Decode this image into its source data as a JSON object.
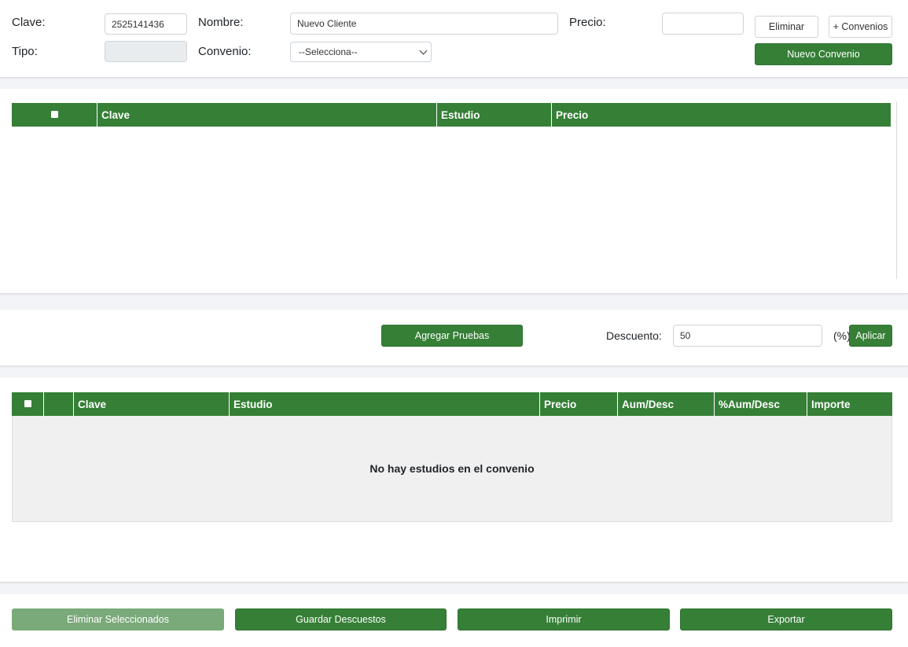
{
  "form": {
    "clave_label": "Clave:",
    "clave_value": "2525141436",
    "nombre_label": "Nombre:",
    "nombre_value": "Nuevo Cliente",
    "precio_label": "Precio:",
    "precio_value": "",
    "tipo_label": "Tipo:",
    "tipo_value": "",
    "convenio_label": "Convenio:",
    "convenio_selected": "--Selecciona--",
    "eliminar_label": "Eliminar",
    "mas_convenios_label": "+ Convenios",
    "nuevo_convenio_label": "Nuevo Convenio"
  },
  "studies_table": {
    "columns": [
      "Clave",
      "Estudio",
      "Precio"
    ],
    "rows": []
  },
  "actions": {
    "agregar_pruebas_label": "Agregar Pruebas",
    "descuento_label": "Descuento:",
    "descuento_value": "50",
    "percent_label": "(%)",
    "aplicar_label": "Aplicar"
  },
  "agreement_table": {
    "columns": [
      "Clave",
      "Estudio",
      "Precio",
      "Aum/Desc",
      "%Aum/Desc",
      "Importe"
    ],
    "empty_message": "No hay estudios en el convenio"
  },
  "footer": {
    "eliminar_seleccionados_label": "Eliminar Seleccionados",
    "guardar_descuestos_label": "Guardar Descuestos",
    "imprimir_label": "Imprimir",
    "exportar_label": "Exportar"
  },
  "colors": {
    "primary_green": "#357f36",
    "faded_green": "#7aaa7a",
    "page_bg": "#f3f4f7"
  }
}
